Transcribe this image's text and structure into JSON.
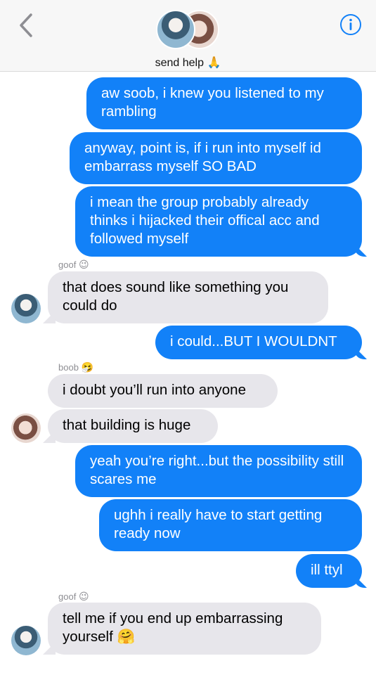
{
  "header": {
    "group_name": "send help",
    "group_emoji": "🙏",
    "back_icon": "chevron-left-icon",
    "info_icon": "info-icon",
    "accent": "#1281f8"
  },
  "colors": {
    "outgoing_bubble": "#1281f8",
    "incoming_bubble": "#e7e6eb",
    "sender_label": "#8e8e93"
  },
  "messages": [
    {
      "direction": "out",
      "text": "aw soob, i knew you listened to my rambling"
    },
    {
      "direction": "out",
      "text": "anyway, point is, if i run into myself id embarrass myself SO BAD"
    },
    {
      "direction": "out",
      "text": "i mean the group probably already thinks i hijacked their offical acc and followed myself"
    },
    {
      "direction": "in",
      "sender": "goof",
      "sender_emoji": "😉",
      "text": "that does sound like something you could do"
    },
    {
      "direction": "out",
      "text": "i could...BUT I WOULDNT"
    },
    {
      "direction": "in",
      "sender": "boob",
      "sender_emoji": "🤧",
      "text": "i doubt you’ll run into anyone"
    },
    {
      "direction": "in",
      "text": "that building is huge"
    },
    {
      "direction": "out",
      "text": "yeah you’re right...but the possibility still scares me"
    },
    {
      "direction": "out",
      "text": "ughh i really have to start getting ready now"
    },
    {
      "direction": "out",
      "text": "ill ttyl"
    },
    {
      "direction": "in",
      "sender": "goof",
      "sender_emoji": "😉",
      "text": "tell me if you end up embarrassing yourself",
      "text_emoji": "🤗"
    }
  ]
}
